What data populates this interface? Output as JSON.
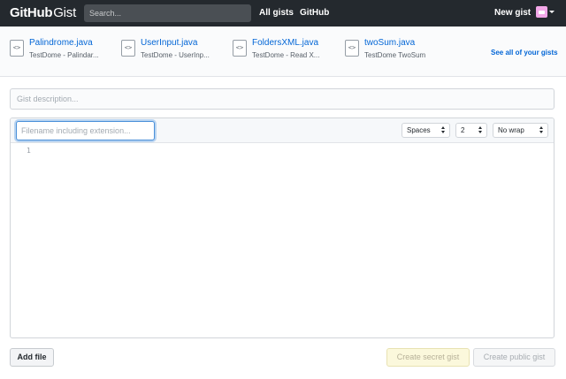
{
  "header": {
    "logo_github": "GitHub",
    "logo_gist": "Gist",
    "search_placeholder": "Search...",
    "nav": {
      "all_gists": "All gists",
      "github": "GitHub"
    },
    "new_gist": "New gist"
  },
  "recent_gists": {
    "items": [
      {
        "name": "Palindrome.java",
        "description": "TestDome - Palindar..."
      },
      {
        "name": "UserInput.java",
        "description": "TestDome - UserInp..."
      },
      {
        "name": "FoldersXML.java",
        "description": "TestDome - Read X..."
      },
      {
        "name": "twoSum.java",
        "description": "TestDome TwoSum"
      }
    ],
    "icon_glyph": "<>",
    "see_all": "See all of your gists"
  },
  "form": {
    "description_placeholder": "Gist description...",
    "filename_placeholder": "Filename including extension...",
    "indent_mode": "Spaces",
    "indent_size": "2",
    "wrap_mode": "No wrap",
    "line_numbers": [
      "1"
    ]
  },
  "buttons": {
    "add_file": "Add file",
    "create_secret": "Create secret gist",
    "create_public": "Create public gist"
  },
  "colors": {
    "header_bg": "#24292e",
    "link": "#0366d6",
    "secret_button_bg": "#fbf8dc"
  }
}
